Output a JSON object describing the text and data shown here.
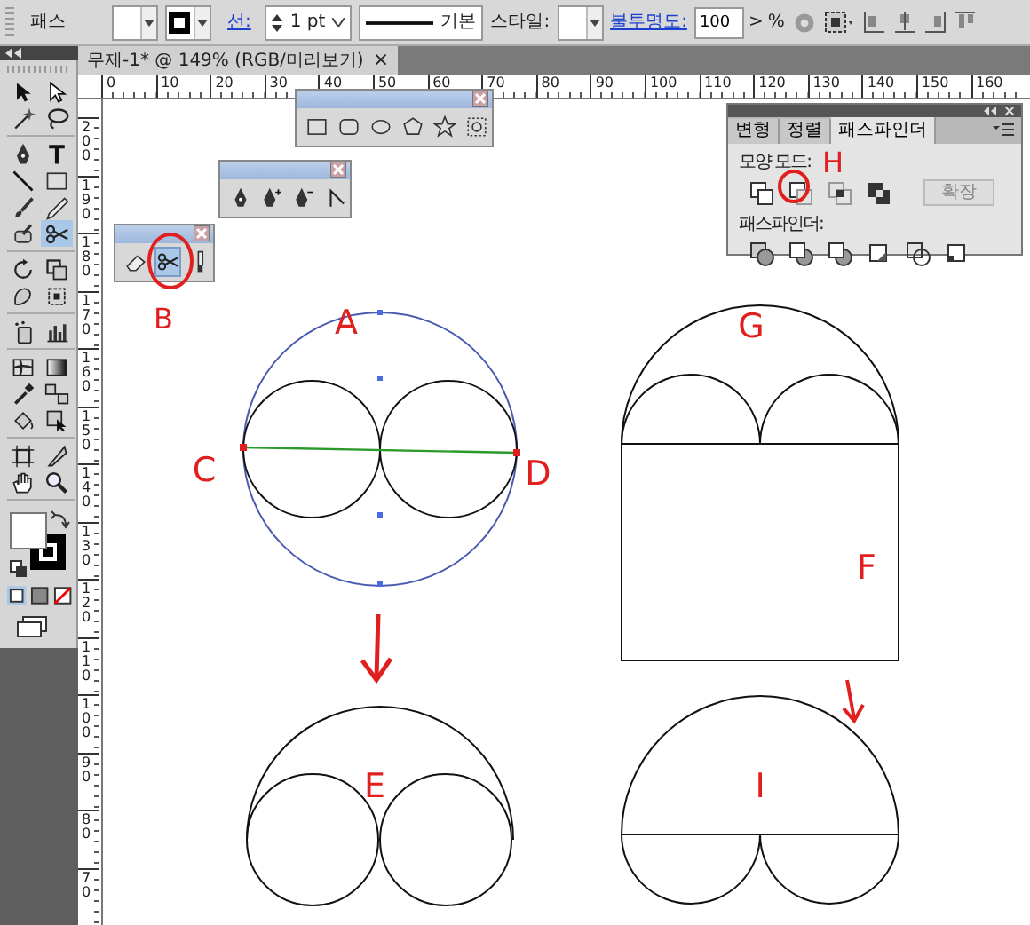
{
  "control_bar": {
    "label": "패스",
    "stroke_label": "선:",
    "stroke_weight": "1 pt",
    "stroke_profile": "기본",
    "style_label": "스타일:",
    "opacity_label": "불투명도:",
    "opacity": "100",
    "opacity_arrow": ">",
    "opacity_unit": "%"
  },
  "document_tab": {
    "title": "무제-1* @ 149% (RGB/미리보기)",
    "close": "×"
  },
  "rulers": {
    "horizontal": [
      "0",
      "10",
      "20",
      "30",
      "40",
      "50",
      "60",
      "70",
      "80",
      "90",
      "100",
      "110",
      "120",
      "130",
      "140",
      "150",
      "160"
    ],
    "vertical": [
      "200",
      "190",
      "180",
      "170",
      "160",
      "150",
      "140",
      "130",
      "120",
      "110",
      "100",
      "90",
      "80",
      "70"
    ]
  },
  "tools": [
    {
      "kind": "selection",
      "selected": false
    },
    {
      "kind": "direct",
      "selected": false
    },
    {
      "kind": "wand",
      "selected": false
    },
    {
      "kind": "lasso",
      "selected": false
    },
    {
      "kind": "pen",
      "selected": false
    },
    {
      "kind": "type",
      "selected": false
    },
    {
      "kind": "line",
      "selected": false
    },
    {
      "kind": "rect",
      "selected": false
    },
    {
      "kind": "brush",
      "selected": false
    },
    {
      "kind": "pencil",
      "selected": false
    },
    {
      "kind": "blob",
      "selected": false
    },
    {
      "kind": "scissors",
      "selected": true
    },
    {
      "kind": "rotate",
      "selected": false
    },
    {
      "kind": "scale",
      "selected": false
    },
    {
      "kind": "warp",
      "selected": false
    },
    {
      "kind": "transform",
      "selected": false
    },
    {
      "kind": "symbol",
      "selected": false
    },
    {
      "kind": "graph",
      "selected": false
    },
    {
      "kind": "mesh",
      "selected": false
    },
    {
      "kind": "gradient",
      "selected": false
    },
    {
      "kind": "eyedropper",
      "selected": false
    },
    {
      "kind": "blend",
      "selected": false
    },
    {
      "kind": "livepaint",
      "selected": false
    },
    {
      "kind": "liveselect",
      "selected": false
    },
    {
      "kind": "artboard",
      "selected": false
    },
    {
      "kind": "slice",
      "selected": false
    },
    {
      "kind": "hand",
      "selected": false
    },
    {
      "kind": "zoom",
      "selected": false
    }
  ],
  "floating_panels": [
    {
      "tools": [
        {
          "kind": "rect",
          "selected": false
        },
        {
          "kind": "roundrect",
          "selected": false
        },
        {
          "kind": "ellipse",
          "selected": false
        },
        {
          "kind": "polygon",
          "selected": false
        },
        {
          "kind": "star",
          "selected": false
        },
        {
          "kind": "flare",
          "selected": false
        }
      ]
    },
    {
      "tools": [
        {
          "kind": "pen",
          "selected": false
        },
        {
          "kind": "penplus",
          "selected": false
        },
        {
          "kind": "penminus",
          "selected": false
        },
        {
          "kind": "anchor",
          "selected": false
        }
      ]
    },
    {
      "tools": [
        {
          "kind": "eraser",
          "selected": false
        },
        {
          "kind": "scissors",
          "selected": true
        },
        {
          "kind": "knife",
          "selected": false
        }
      ]
    }
  ],
  "pathfinder_panel": {
    "tabs": [
      {
        "label": "변형",
        "selected": false
      },
      {
        "label": "정렬",
        "selected": false
      },
      {
        "label": "패스파인더",
        "selected": true
      }
    ],
    "shape_modes_label": "모양 모드:",
    "expand_button": {
      "label": "확장",
      "disabled": true
    },
    "pathfinders_label": "패스파인더:"
  },
  "annotations": [
    {
      "text": "H"
    },
    {
      "text": "B"
    },
    {
      "text": "A"
    },
    {
      "text": "G"
    },
    {
      "text": "C"
    },
    {
      "text": "D"
    },
    {
      "text": "F"
    },
    {
      "text": "E"
    },
    {
      "text": "I"
    }
  ]
}
